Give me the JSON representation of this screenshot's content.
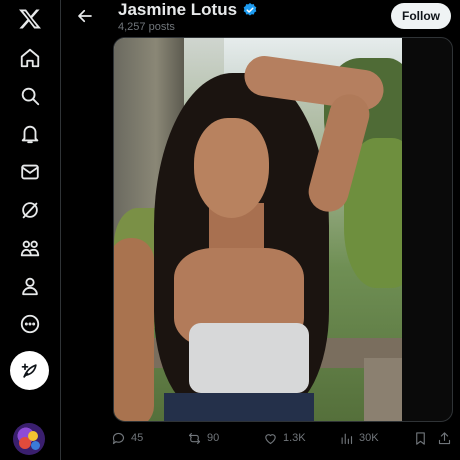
{
  "nav": {
    "items": [
      {
        "name": "x-logo-icon"
      },
      {
        "name": "home-icon"
      },
      {
        "name": "search-icon"
      },
      {
        "name": "notifications-icon"
      },
      {
        "name": "messages-icon"
      },
      {
        "name": "grok-icon"
      },
      {
        "name": "communities-icon"
      },
      {
        "name": "profile-icon"
      },
      {
        "name": "more-icon"
      }
    ],
    "post_button_icon": "compose-icon"
  },
  "header": {
    "name": "Jasmine Lotus",
    "verified": true,
    "post_count": "4,257 posts",
    "follow_label": "Follow"
  },
  "actions": {
    "replies": "45",
    "reposts": "90",
    "likes": "1.3K",
    "views": "30K"
  },
  "colors": {
    "background": "#000000",
    "text_primary": "#e7e9ea",
    "text_secondary": "#71767b",
    "verified_blue": "#1d9bf0",
    "follow_bg": "#eff3f4"
  }
}
